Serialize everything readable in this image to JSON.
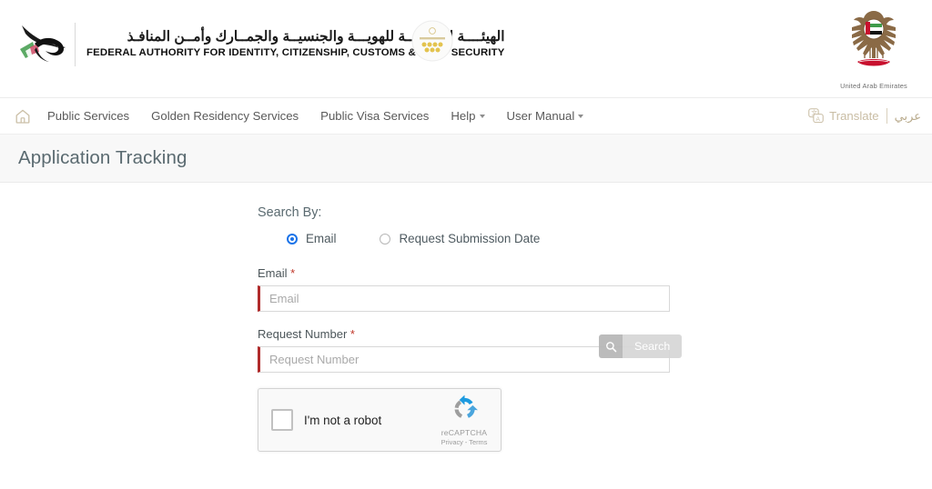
{
  "header": {
    "brand": {
      "arabic": "الهيئــــة الاتحاديــة للهويـــة والجنسيــة والجمــارك وأمــن المنافـذ",
      "english": "FEDERAL AUTHORITY FOR IDENTITY, CITIZENSHIP, CUSTOMS & PORT SECURITY",
      "falcon_logo_icon": "falcon-logo-icon",
      "anniversary_emblem_icon": "anniversary-emblem-icon"
    },
    "uae_emblem": {
      "icon": "uae-falcon-emblem-icon",
      "caption": "United Arab Emirates"
    }
  },
  "nav": {
    "home_icon": "home-icon",
    "items": [
      {
        "label": "Public Services",
        "has_caret": false
      },
      {
        "label": "Golden Residency Services",
        "has_caret": false
      },
      {
        "label": "Public Visa Services",
        "has_caret": false
      },
      {
        "label": "Help",
        "has_caret": true
      },
      {
        "label": "User Manual",
        "has_caret": true
      }
    ],
    "translate": {
      "icon": "translate-icon",
      "label": "Translate"
    },
    "arabic_link": "عربي"
  },
  "page": {
    "title": "Application Tracking"
  },
  "form": {
    "search_by_label": "Search By:",
    "radio_options": [
      {
        "label": "Email",
        "selected": true
      },
      {
        "label": "Request Submission Date",
        "selected": false
      }
    ],
    "fields": [
      {
        "label": "Email",
        "required_mark": "*",
        "placeholder": "Email",
        "value": ""
      },
      {
        "label": "Request Number",
        "required_mark": "*",
        "placeholder": "Request Number",
        "value": ""
      }
    ],
    "recaptcha": {
      "checkbox_label": "I'm not a robot",
      "brand_name": "reCAPTCHA",
      "terms": "Privacy - Terms",
      "checked": false,
      "logo_icon": "recaptcha-logo-icon"
    },
    "search_button": {
      "label": "Search",
      "icon": "search-icon",
      "disabled": true
    }
  },
  "colors": {
    "required_border": "#b02b2b",
    "required_star": "#c0392b",
    "radio_selected": "#1a73e8",
    "translate_text": "#c9bda4",
    "title_text": "#5a6a70",
    "title_band_bg": "#f8f8f8",
    "button_disabled_bg": "#d6d6d6",
    "button_icon_bg": "#b6b6b6"
  }
}
